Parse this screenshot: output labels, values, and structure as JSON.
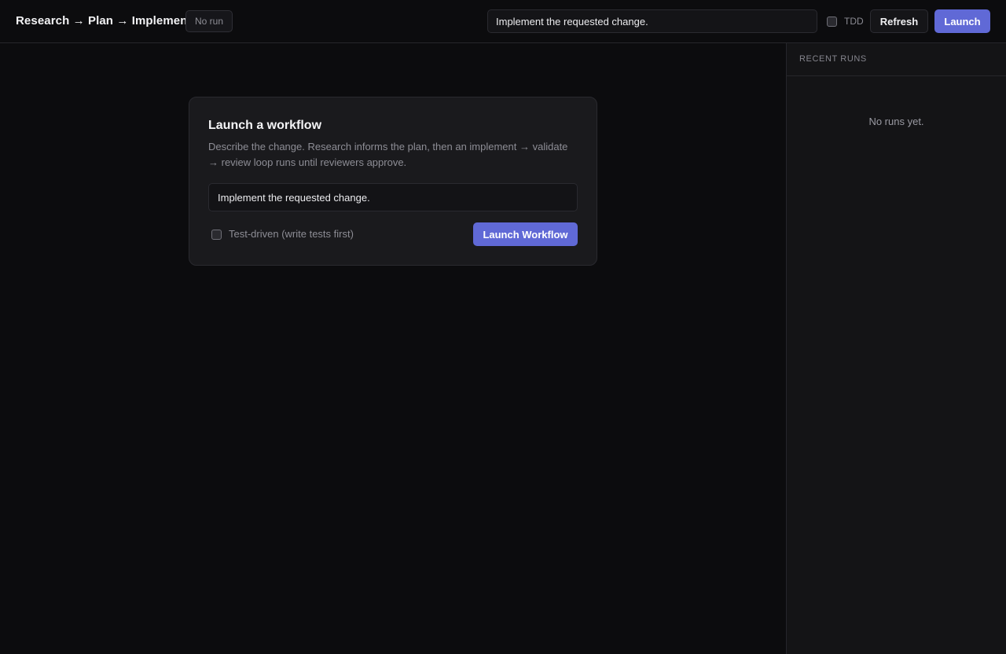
{
  "header": {
    "title": "Research → Plan → Implement",
    "run_status": "No run",
    "prompt_value": "Implement the requested change.",
    "tdd_label": "TDD",
    "tdd_checked": false,
    "refresh_label": "Refresh",
    "launch_label": "Launch"
  },
  "launch_card": {
    "title": "Launch a workflow",
    "description": "Describe the change. Research informs the plan, then an implement → validate → review loop runs until reviewers approve.",
    "prompt_value": "Implement the requested change.",
    "tdd_label": "Test-driven (write tests first)",
    "tdd_checked": false,
    "submit_label": "Launch Workflow"
  },
  "sidebar": {
    "title": "RECENT RUNS",
    "empty_message": "No runs yet."
  },
  "colors": {
    "background": "#0c0c0e",
    "card": "#1a1a1d",
    "accent": "#6069d6",
    "border": "#26262b"
  }
}
